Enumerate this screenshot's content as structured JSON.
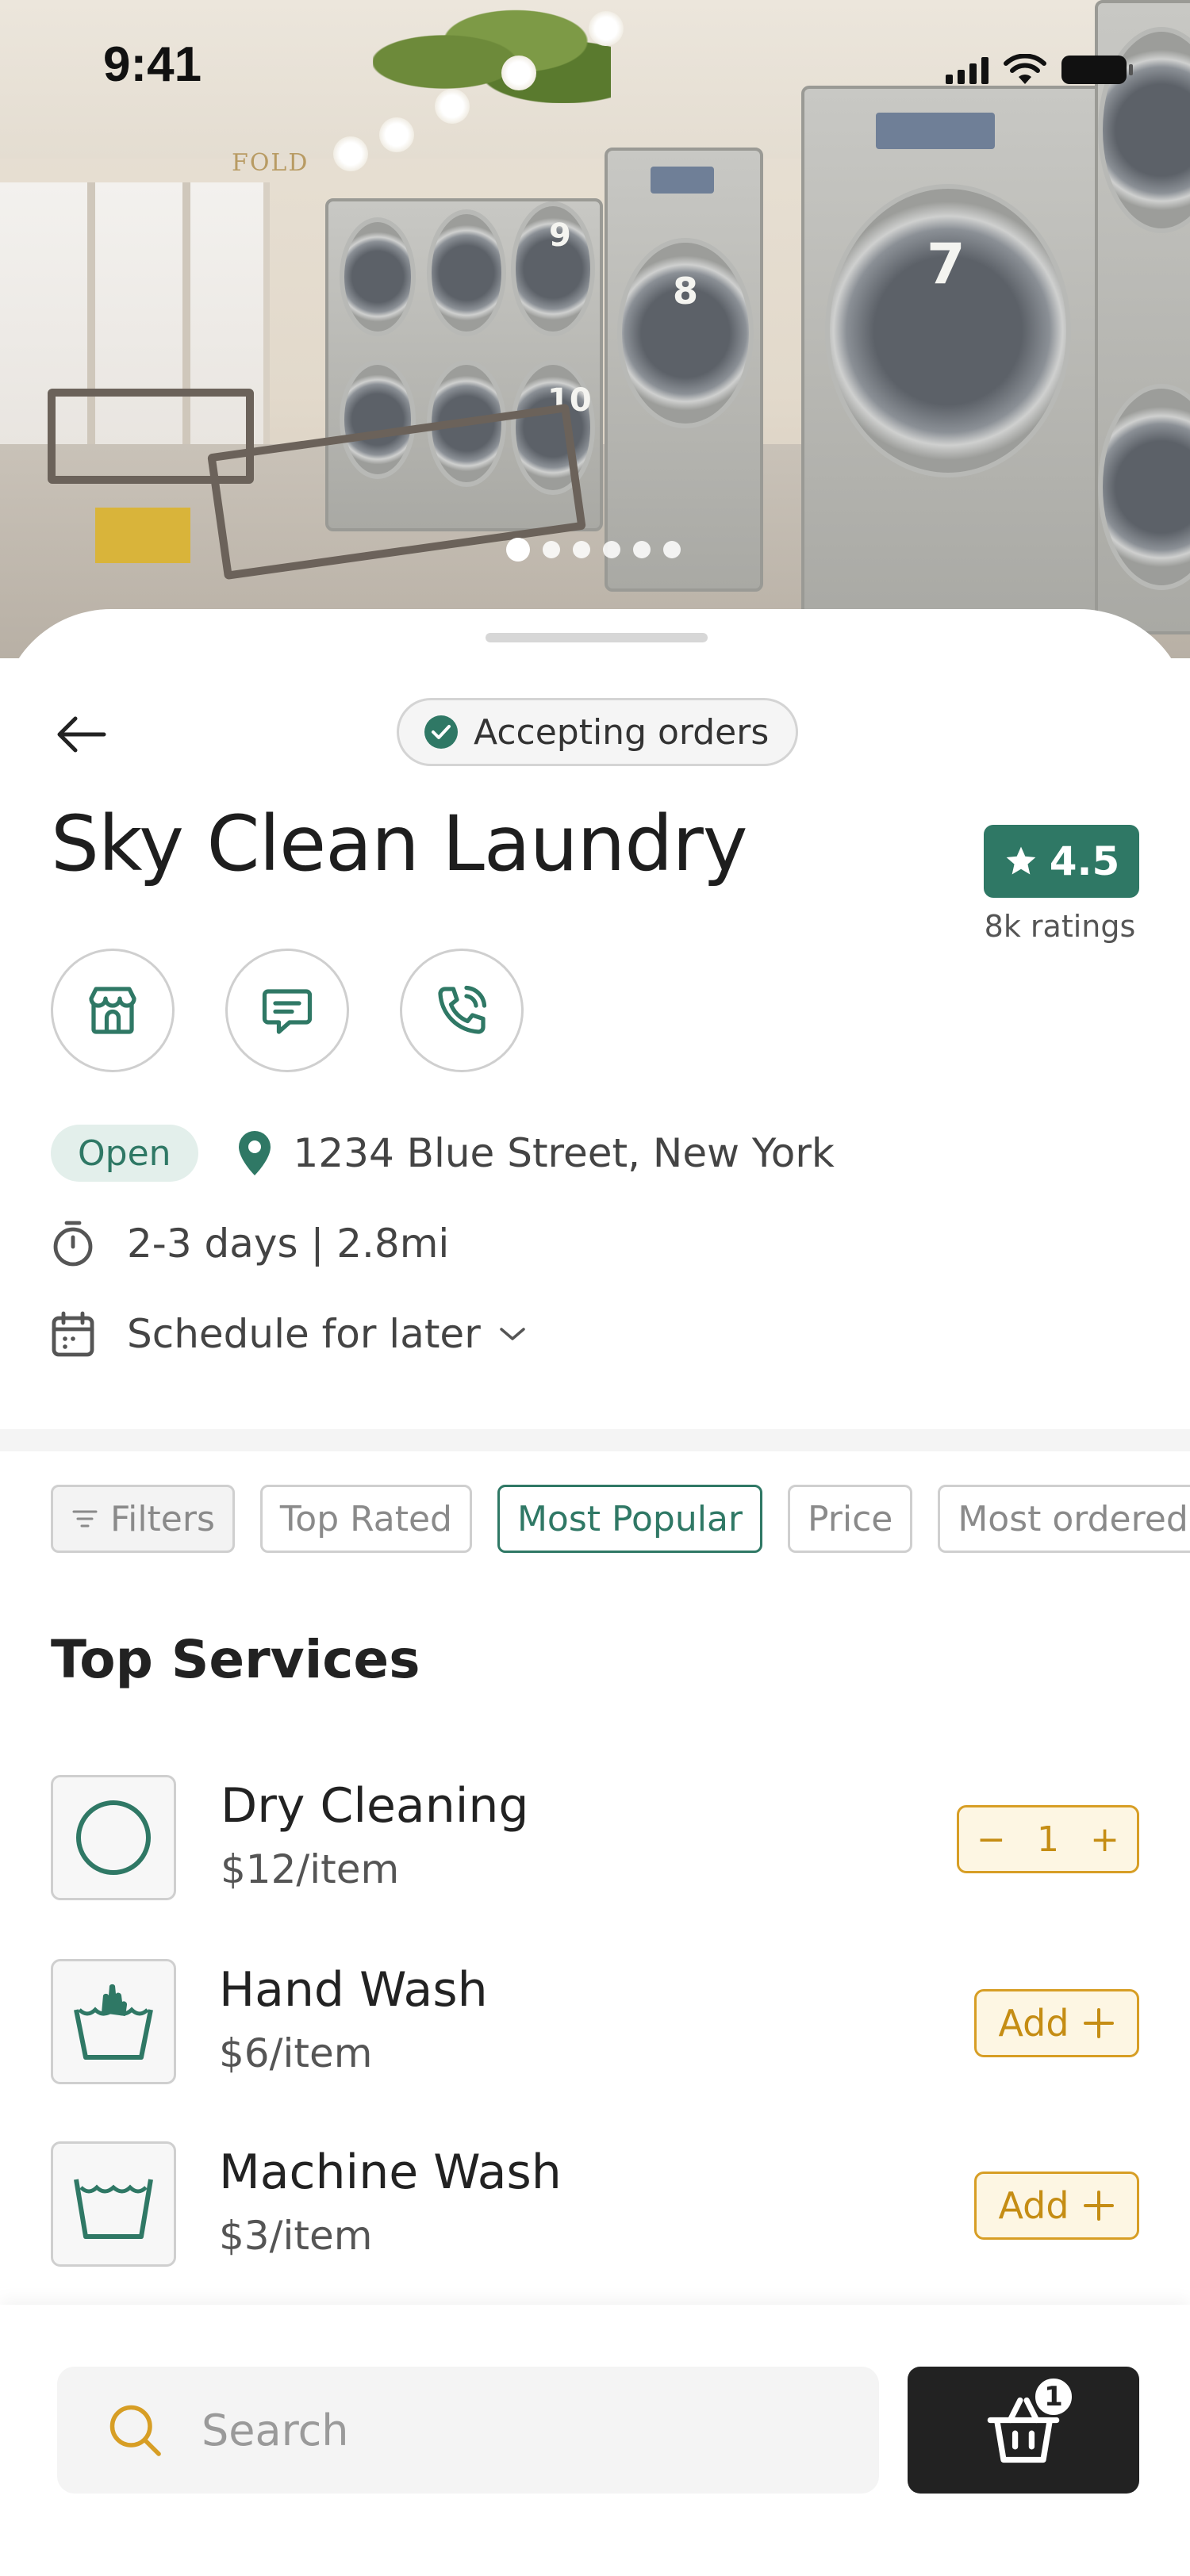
{
  "status_bar": {
    "time": "9:41"
  },
  "hero": {
    "sign_text": "FOLD",
    "machine_numbers": [
      "9",
      "8",
      "10",
      "7"
    ],
    "carousel": {
      "total": 6,
      "active_index": 0
    }
  },
  "header": {
    "accepting_label": "Accepting orders",
    "store_name": "Sky Clean Laundry",
    "rating": "4.5",
    "rating_count": "8k ratings"
  },
  "info": {
    "open_label": "Open",
    "address": "1234 Blue Street, New York",
    "delivery": "2-3 days | 2.8mi",
    "schedule_label": "Schedule for later"
  },
  "filters": {
    "chips": [
      "Filters",
      "Top Rated",
      "Most Popular",
      "Price",
      "Most ordered"
    ],
    "active": "Most Popular"
  },
  "services": {
    "title": "Top Services",
    "items": [
      {
        "name": "Dry Cleaning",
        "price": "$12/item",
        "icon": "dry-clean-circle-icon",
        "quantity": "1",
        "minus": "−",
        "plus": "+"
      },
      {
        "name": "Hand Wash",
        "price": "$6/item",
        "icon": "hand-wash-icon",
        "add_label": "Add"
      },
      {
        "name": "Machine Wash",
        "price": "$3/item",
        "icon": "machine-wash-icon",
        "add_label": "Add"
      }
    ]
  },
  "bottom": {
    "search_placeholder": "Search",
    "cart_count": "1"
  },
  "colors": {
    "brand_green": "#2f7865",
    "accent_orange": "#d79e25",
    "dark": "#222222"
  }
}
